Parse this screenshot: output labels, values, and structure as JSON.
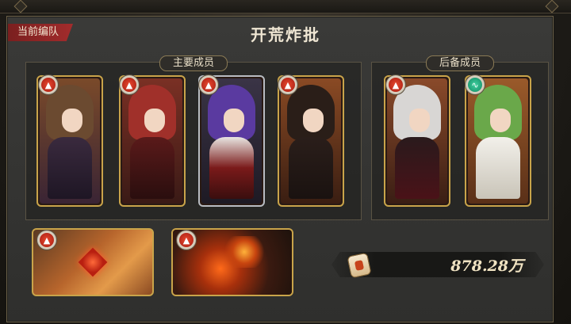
{
  "screen": {
    "title": "开荒炸批",
    "team_tag": "当前编队"
  },
  "main_group": {
    "label": "主要成员",
    "members": [
      {
        "element": "fire-icon",
        "frame": "gold"
      },
      {
        "element": "fire-icon",
        "frame": "gold"
      },
      {
        "element": "fire-icon",
        "frame": "silver"
      },
      {
        "element": "fire-icon",
        "frame": "gold"
      }
    ]
  },
  "reserve_group": {
    "label": "后备成员",
    "members": [
      {
        "element": "fire-icon",
        "frame": "gold"
      },
      {
        "element": "wind-icon",
        "frame": "gold"
      }
    ]
  },
  "equipment": [
    {
      "element": "fire-icon",
      "item": "crystal-relic"
    },
    {
      "element": "fire-icon",
      "item": "lava-creature"
    }
  ],
  "power": {
    "value": "878.28万"
  },
  "colors": {
    "gold_frame": "#c9a44a",
    "tag_red": "#a32c2c",
    "fire": "#c8301a",
    "wind": "#1ea878"
  }
}
